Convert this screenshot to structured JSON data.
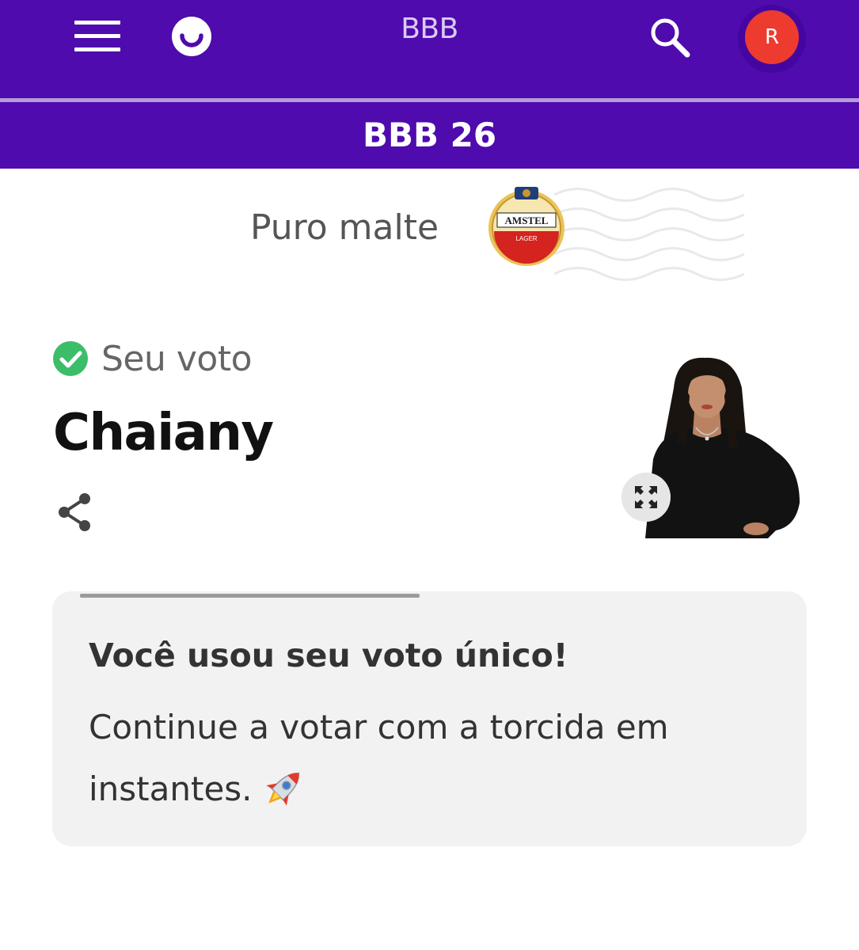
{
  "header": {
    "title": "BBB",
    "menu_icon": "hamburger-menu-icon",
    "logo_icon": "smile-logo-icon",
    "search_icon": "search-icon",
    "avatar_initial": "R",
    "bg_color": "#4f0bad",
    "avatar_color": "#ee3b2f"
  },
  "subheader": {
    "title": "BBB 26"
  },
  "sponsor": {
    "text": "Puro malte",
    "logo_text": "AMSTEL",
    "logo_subtext": "LAGER"
  },
  "vote": {
    "label": "Seu voto",
    "candidate": "Chaiany",
    "check_icon": "check-circle-icon",
    "share_icon": "share-icon",
    "expand_icon": "expand-icon",
    "check_color": "#3dbd6a"
  },
  "card": {
    "title": "Você usou seu voto único!",
    "message": "Continue a votar com a torcida em instantes.",
    "rocket_icon": "rocket-icon"
  }
}
